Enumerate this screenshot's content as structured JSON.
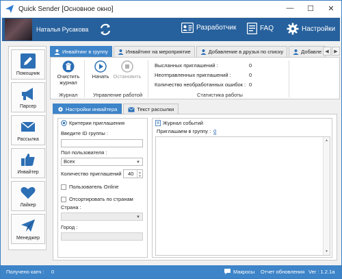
{
  "window": {
    "title": "Quick Sender [Основное окно]"
  },
  "header": {
    "user_name": "Наталья Русакова",
    "developer_label": "Разработчик",
    "faq_label": "FAQ",
    "settings_label": "Настройки"
  },
  "sidebar": {
    "items": [
      {
        "label": "Помощник",
        "icon": "pencil-icon"
      },
      {
        "label": "Парсер",
        "icon": "megaphone-icon"
      },
      {
        "label": "Рассылка",
        "icon": "envelope-icon"
      },
      {
        "label": "Инвайтер",
        "icon": "thumbs-up-icon"
      },
      {
        "label": "Лайкер",
        "icon": "heart-icon"
      },
      {
        "label": "Менеджер",
        "icon": "paper-plane-icon"
      }
    ]
  },
  "tabs": [
    {
      "label": "Инвайтинг в группу",
      "active": true
    },
    {
      "label": "Инвайтинг на мероприятие",
      "active": false
    },
    {
      "label": "Добавление в друзья по списку",
      "active": false
    },
    {
      "label": "Добавле",
      "active": false
    }
  ],
  "ribbon": {
    "clear_log": "Очистить журнал",
    "start": "Начать",
    "stop": "Остановить",
    "group_journal": "Журнал",
    "group_control": "Управление работой",
    "group_stats": "Статистика работы",
    "stats": [
      {
        "label": "Высланных приглашений :",
        "value": "0"
      },
      {
        "label": "Неотправленных приглашений :",
        "value": "0"
      },
      {
        "label": "Количество необработанных ошибок :",
        "value": "0"
      }
    ]
  },
  "subtabs": [
    {
      "label": "Настройки инвайтера",
      "active": true
    },
    {
      "label": "Текст рассылки",
      "active": false
    }
  ],
  "criteria": {
    "title": "Критерии приглашения",
    "group_id_label": "Введите ID группы :",
    "group_id_value": "",
    "gender_label": "Пол пользователя :",
    "gender_value": "Всех",
    "count_label": "Количество приглашений :",
    "count_value": "40",
    "online_label": "Пользователь Online",
    "filter_country_label": "Отсортировать по странам",
    "country_label": "Страна :",
    "country_value": "",
    "city_label": "Город :",
    "city_value": ""
  },
  "journal": {
    "title": "Журнал событий",
    "invite_label": "Приглашаем в группу :",
    "invite_value": "0"
  },
  "status": {
    "captcha_label": "Получено капч :",
    "captcha_value": "0",
    "macros": "Макросы",
    "report": "Отчет обновления",
    "version": "Ver : 1.2.1a"
  },
  "colors": {
    "accent": "#3d84c9",
    "header": "#27619d",
    "icon_blue": "#2c6fb5"
  }
}
